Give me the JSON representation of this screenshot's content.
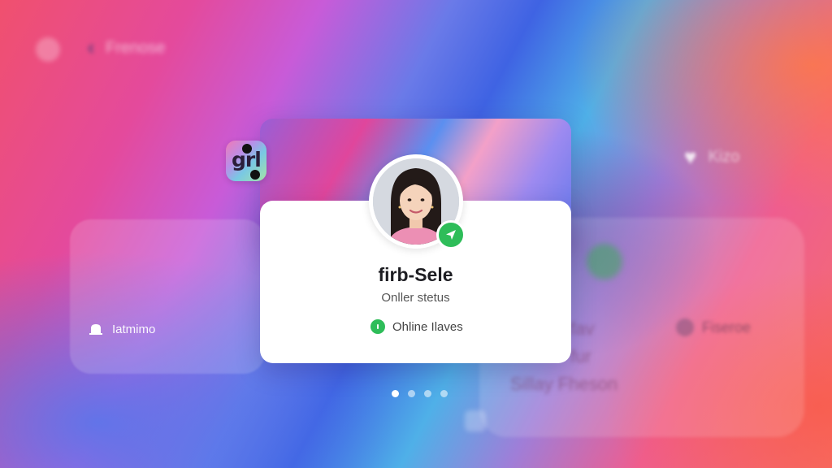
{
  "header": {
    "back_label": "Frenose"
  },
  "left_panel": {
    "item_label": "Iatmimo"
  },
  "right_panel": {
    "top_label": "Kizo",
    "user_label": "Fiseroe",
    "ghost_lines": [
      "fav",
      "fur",
      "Sillay Fheson"
    ]
  },
  "app": {
    "logo_text": "grl"
  },
  "profile_card": {
    "name": "firb-Sele",
    "status": "Onller stetus",
    "online_label": "Ohline Ilaves"
  },
  "pager": {
    "count": 4,
    "active_index": 0
  },
  "colors": {
    "accent_green": "#2ebd59",
    "card_bg": "#ffffff"
  }
}
